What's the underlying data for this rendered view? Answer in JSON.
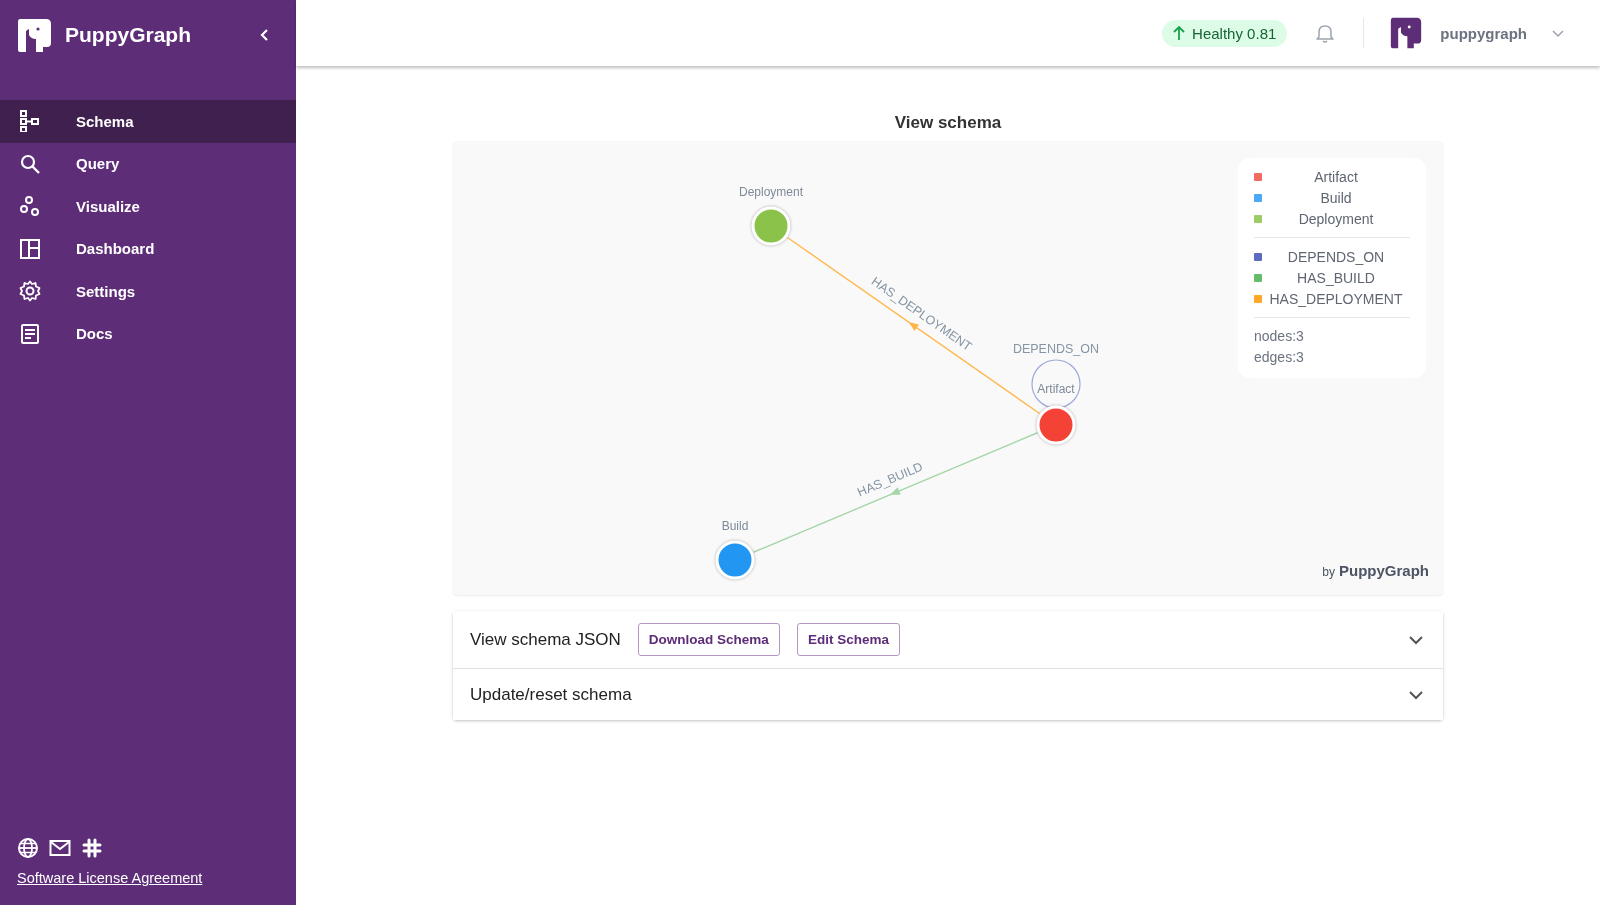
{
  "sidebar": {
    "brand": "PuppyGraph",
    "items": [
      {
        "label": "Schema",
        "selected": true
      },
      {
        "label": "Query",
        "selected": false
      },
      {
        "label": "Visualize",
        "selected": false
      },
      {
        "label": "Dashboard",
        "selected": false
      },
      {
        "label": "Settings",
        "selected": false
      },
      {
        "label": "Docs",
        "selected": false
      }
    ],
    "footer_link": "Software License Agreement"
  },
  "header": {
    "health": "Healthy 0.81",
    "user": "puppygraph"
  },
  "page_title": "View schema",
  "graph": {
    "nodes": [
      {
        "label": "Artifact",
        "color": "#f44336"
      },
      {
        "label": "Deployment",
        "color": "#8bc34a"
      },
      {
        "label": "Build",
        "color": "#2196f3"
      }
    ],
    "edges": [
      {
        "label": "DEPENDS_ON",
        "color": "#9fa8da"
      },
      {
        "label": "HAS_DEPLOYMENT",
        "color": "#ffb74d"
      },
      {
        "label": "HAS_BUILD",
        "color": "#a5d6a7"
      }
    ],
    "legend": {
      "node_types": [
        {
          "label": "Artifact",
          "color": "#f26b62"
        },
        {
          "label": "Build",
          "color": "#4aa8f5"
        },
        {
          "label": "Deployment",
          "color": "#9ccc65"
        }
      ],
      "edge_types": [
        {
          "label": "DEPENDS_ON",
          "color": "#5c6bc0"
        },
        {
          "label": "HAS_BUILD",
          "color": "#66bb6a"
        },
        {
          "label": "HAS_DEPLOYMENT",
          "color": "#ffa726"
        }
      ],
      "stats": [
        "nodes:3",
        "edges:3"
      ]
    },
    "credit_by": "by",
    "credit_brand": "PuppyGraph"
  },
  "accordions": [
    {
      "title": "View schema JSON",
      "expanded": false,
      "buttons": [
        "Download Schema",
        "Edit Schema"
      ]
    },
    {
      "title": "Update/reset schema",
      "expanded": false
    }
  ]
}
